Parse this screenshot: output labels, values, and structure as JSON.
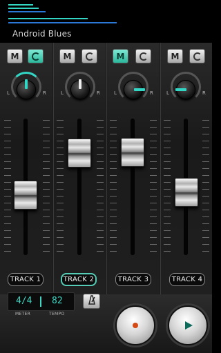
{
  "header": {
    "song_title": "Android Blues",
    "meter_colors": [
      "#33d6c4",
      "#2a79d8",
      "#33d6c4",
      "#2a79d8",
      "#33d6c4"
    ]
  },
  "channels": [
    {
      "mute_label": "M",
      "mute_on": false,
      "loop_icon": "loop-icon",
      "loop_on": true,
      "pan_left": "L",
      "pan_right": "R",
      "pan_position": "center",
      "fader_level": 0.42,
      "track_label": "TRACK 1",
      "selected": false
    },
    {
      "mute_label": "M",
      "mute_on": false,
      "loop_icon": "loop-icon",
      "loop_on": false,
      "pan_left": "L",
      "pan_right": "R",
      "pan_position": "center",
      "fader_level": 0.75,
      "track_label": "TRACK 2",
      "selected": true
    },
    {
      "mute_label": "M",
      "mute_on": true,
      "loop_icon": "loop-icon",
      "loop_on": false,
      "pan_left": "L",
      "pan_right": "R",
      "pan_position": "right",
      "fader_level": 0.75,
      "track_label": "TRACK 3",
      "selected": false
    },
    {
      "mute_label": "M",
      "mute_on": false,
      "loop_icon": "loop-icon",
      "loop_on": false,
      "pan_left": "L",
      "pan_right": "R",
      "pan_position": "left",
      "fader_level": 0.43,
      "track_label": "TRACK 4",
      "selected": false
    }
  ],
  "transport": {
    "meter_value": "4/4",
    "tempo_value": "82",
    "meter_caption": "METER",
    "tempo_caption": "TEMPO",
    "metronome_icon": "metronome-icon",
    "record_icon": "record-icon",
    "play_icon": "play-icon"
  },
  "colors": {
    "accent": "#33d6c4",
    "record": "#d44a14"
  }
}
